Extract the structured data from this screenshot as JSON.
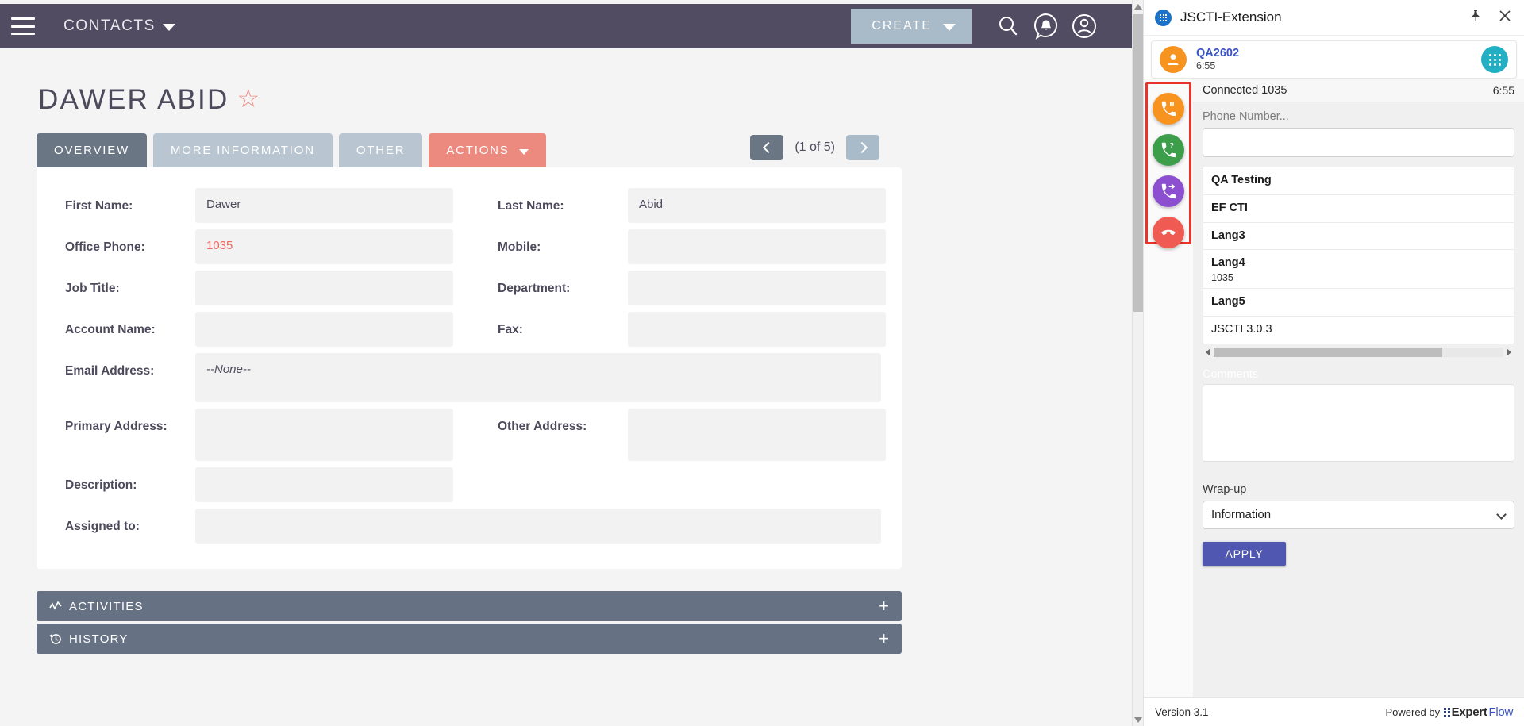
{
  "crm": {
    "navbar": {
      "menu_icon": "hamburger-icon",
      "module_title": "CONTACTS",
      "create_label": "CREATE",
      "search_icon": "search-icon",
      "notifications_icon": "notification-bell-icon",
      "profile_icon": "user-profile-icon"
    },
    "contact": {
      "title": "DAWER ABID",
      "favorite_icon": "star-icon",
      "tabs": [
        {
          "label": "OVERVIEW",
          "active": true
        },
        {
          "label": "MORE INFORMATION",
          "active": false
        },
        {
          "label": "OTHER",
          "active": false
        },
        {
          "label": "ACTIONS",
          "active": false,
          "dropdown": true
        }
      ],
      "pager": {
        "prev_icon": "chevron-left-icon",
        "label": "(1 of 5)",
        "next_icon": "chevron-right-icon"
      },
      "fields": {
        "first_name_label": "First Name:",
        "first_name_value": "Dawer",
        "last_name_label": "Last Name:",
        "last_name_value": "Abid",
        "office_phone_label": "Office Phone:",
        "office_phone_value": "1035",
        "mobile_label": "Mobile:",
        "mobile_value": "",
        "job_title_label": "Job Title:",
        "job_title_value": "",
        "department_label": "Department:",
        "department_value": "",
        "account_name_label": "Account Name:",
        "account_name_value": "",
        "fax_label": "Fax:",
        "fax_value": "",
        "email_label": "Email Address:",
        "email_value": "--None--",
        "primary_address_label": "Primary Address:",
        "primary_address_value": "",
        "other_address_label": "Other Address:",
        "other_address_value": "",
        "description_label": "Description:",
        "description_value": "",
        "assigned_to_label": "Assigned to:",
        "assigned_to_value": ""
      },
      "accordions": [
        {
          "label": "ACTIVITIES",
          "icon": "activity-chart-icon",
          "expand": "+"
        },
        {
          "label": "HISTORY",
          "icon": "history-clock-icon",
          "expand": "+"
        }
      ]
    }
  },
  "cti": {
    "header": {
      "app_icon": "grid-app-icon",
      "title": "JSCTI-Extension",
      "pin_icon": "pin-icon",
      "close_icon": "close-icon"
    },
    "agent": {
      "avatar_icon": "user-avatar-icon",
      "name": "QA2602",
      "timer": "6:55",
      "dialpad_icon": "dialpad-icon"
    },
    "call_controls": [
      {
        "name": "hold-call-button",
        "icon": "phone-pause-icon",
        "color": "#f7931e"
      },
      {
        "name": "consult-call-button",
        "icon": "phone-question-icon",
        "color": "#3c9e4b"
      },
      {
        "name": "transfer-call-button",
        "icon": "phone-forward-icon",
        "color": "#8b4fcf"
      },
      {
        "name": "end-call-button",
        "icon": "phone-hangup-icon",
        "color": "#ef5a52"
      }
    ],
    "highlight_color": "#e8342a",
    "call_status": {
      "label": "Connected 1035",
      "timer": "6:55"
    },
    "phone": {
      "label": "Phone Number...",
      "value": "",
      "placeholder": ""
    },
    "directory": [
      {
        "name": "QA Testing",
        "extension": ""
      },
      {
        "name": "EF CTI",
        "extension": ""
      },
      {
        "name": "Lang3",
        "extension": ""
      },
      {
        "name": "Lang4",
        "extension": "1035"
      },
      {
        "name": "Lang5",
        "extension": ""
      },
      {
        "name": "JSCTI 3.0.3",
        "extension": ""
      }
    ],
    "comments": {
      "label": "Comments",
      "value": ""
    },
    "wrapup": {
      "label": "Wrap-up",
      "selected": "Information",
      "options": [
        "Information"
      ],
      "apply_label": "APPLY"
    },
    "footer": {
      "version": "Version 3.1",
      "powered_by": "Powered by",
      "brand_first": "Expert",
      "brand_second": "Flow"
    }
  }
}
